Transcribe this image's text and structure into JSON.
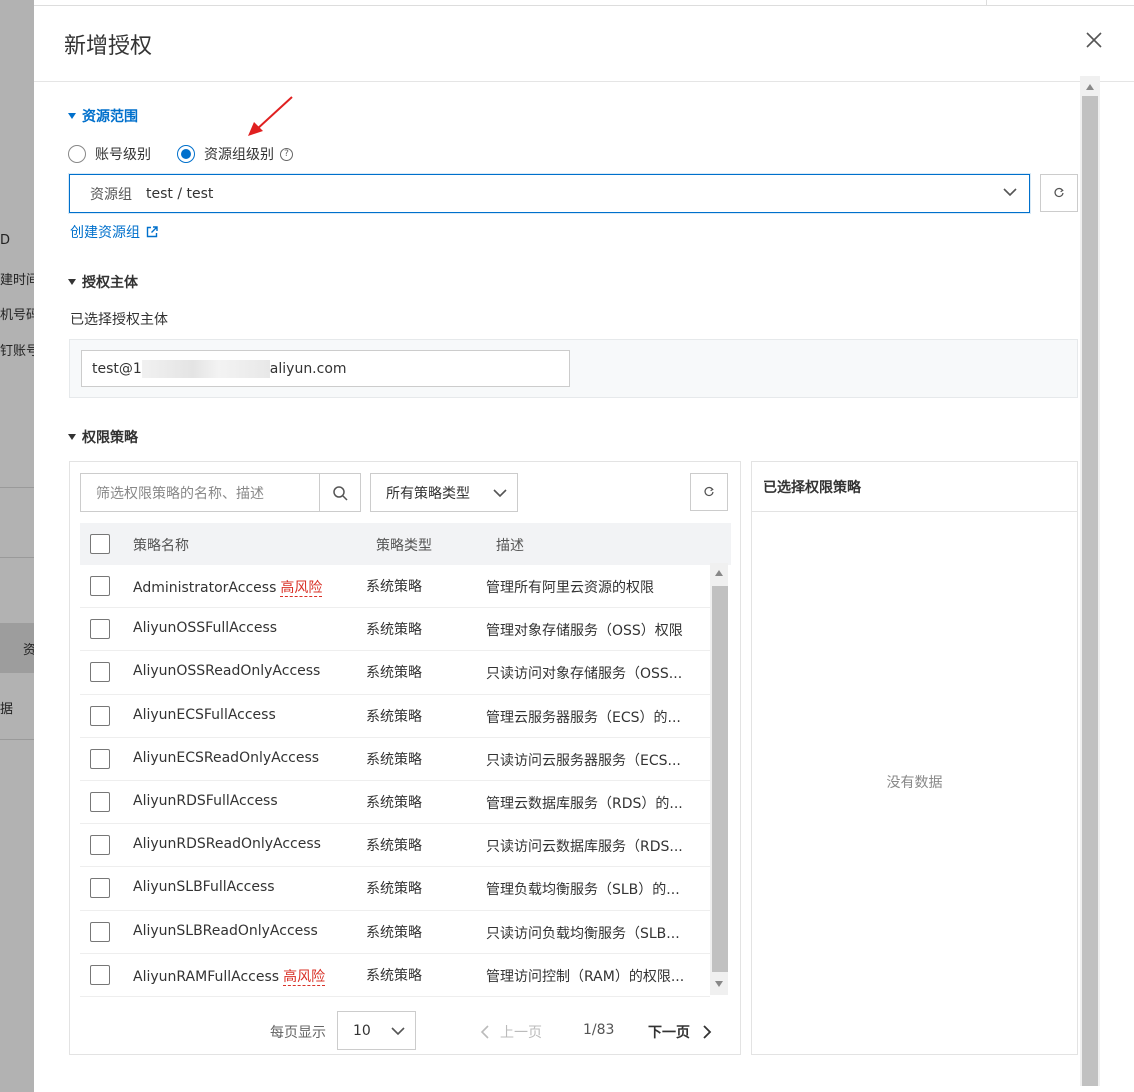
{
  "background_page": {
    "fragments": [
      "D",
      "建时间",
      "机号码",
      "钉账号",
      "资",
      "据"
    ]
  },
  "drawer": {
    "title": "新增授权",
    "close_icon": "close-icon"
  },
  "resource_scope": {
    "section_title": "资源范围",
    "options": [
      {
        "label": "账号级别",
        "selected": false
      },
      {
        "label": "资源组级别",
        "selected": true
      }
    ],
    "select_prefix": "资源组",
    "select_value": "test / test",
    "create_link": "创建资源组"
  },
  "principal": {
    "section_title": "授权主体",
    "selected_label": "已选择授权主体",
    "value_prefix": "test@1",
    "value_suffix": "aliyun.com"
  },
  "policies": {
    "section_title": "权限策略",
    "search_placeholder": "筛选权限策略的名称、描述",
    "type_filter": "所有策略类型",
    "columns": [
      "策略名称",
      "策略类型",
      "描述"
    ],
    "risk_label": "高风险",
    "rows": [
      {
        "name": "AdministratorAccess",
        "risk": true,
        "type": "系统策略",
        "desc": "管理所有阿里云资源的权限"
      },
      {
        "name": "AliyunOSSFullAccess",
        "risk": false,
        "type": "系统策略",
        "desc": "管理对象存储服务（OSS）权限"
      },
      {
        "name": "AliyunOSSReadOnlyAccess",
        "risk": false,
        "type": "系统策略",
        "desc": "只读访问对象存储服务（OSS..."
      },
      {
        "name": "AliyunECSFullAccess",
        "risk": false,
        "type": "系统策略",
        "desc": "管理云服务器服务（ECS）的..."
      },
      {
        "name": "AliyunECSReadOnlyAccess",
        "risk": false,
        "type": "系统策略",
        "desc": "只读访问云服务器服务（ECS..."
      },
      {
        "name": "AliyunRDSFullAccess",
        "risk": false,
        "type": "系统策略",
        "desc": "管理云数据库服务（RDS）的..."
      },
      {
        "name": "AliyunRDSReadOnlyAccess",
        "risk": false,
        "type": "系统策略",
        "desc": "只读访问云数据库服务（RDS..."
      },
      {
        "name": "AliyunSLBFullAccess",
        "risk": false,
        "type": "系统策略",
        "desc": "管理负载均衡服务（SLB）的..."
      },
      {
        "name": "AliyunSLBReadOnlyAccess",
        "risk": false,
        "type": "系统策略",
        "desc": "只读访问负载均衡服务（SLB..."
      },
      {
        "name": "AliyunRAMFullAccess",
        "risk": true,
        "type": "系统策略",
        "desc": "管理访问控制（RAM）的权限..."
      }
    ],
    "pager": {
      "per_page_label": "每页显示",
      "per_page": "10",
      "prev": "上一页",
      "page": "1/83",
      "next": "下一页"
    }
  },
  "selected_policies": {
    "title": "已选择权限策略",
    "empty_text": "没有数据"
  },
  "colors": {
    "accent": "#0070cc",
    "risk": "#d93026"
  }
}
